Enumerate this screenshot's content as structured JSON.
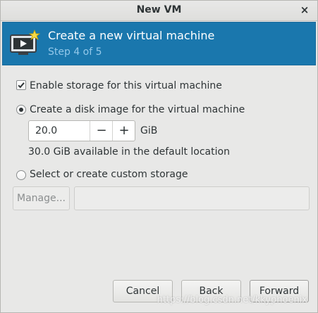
{
  "window": {
    "title": "New VM",
    "close_glyph": "×"
  },
  "header": {
    "icon": "vm-icon",
    "title": "Create a new virtual machine",
    "step": "Step 4 of 5"
  },
  "storage": {
    "enable_label": "Enable storage for this virtual machine",
    "enable_checked": true,
    "create_disk_label": "Create a disk image for the virtual machine",
    "create_disk_selected": true,
    "disk_size_value": "20.0",
    "decrement_glyph": "−",
    "increment_glyph": "+",
    "unit": "GiB",
    "available_text": "30.0 GiB available in the default location",
    "custom_label": "Select or create custom storage",
    "custom_selected": false,
    "manage_label": "Manage...",
    "custom_path_value": ""
  },
  "buttons": {
    "cancel": "Cancel",
    "back": "Back",
    "forward": "Forward"
  },
  "watermark": "https://blog.csdn.net/kkyphoenix",
  "colors": {
    "header_bg": "#1a77ad",
    "header_step": "#93c8ea",
    "window_bg": "#e8e8e7"
  }
}
